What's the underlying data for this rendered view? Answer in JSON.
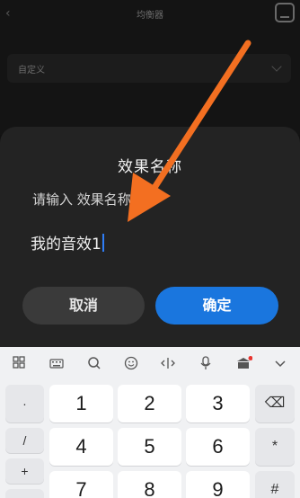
{
  "app": {
    "title": "均衡器",
    "preset_value": "自定义"
  },
  "dialog": {
    "title": "效果名称",
    "hint": "请输入 效果名称",
    "input_value": "我的音效1",
    "cancel_label": "取消",
    "confirm_label": "确定"
  },
  "keyboard": {
    "toolbar_icons": [
      "grid-icon",
      "keyboard-icon",
      "search-icon",
      "emoji-icon",
      "cursor-move-icon",
      "microphone-icon",
      "shop-icon",
      "collapse-icon"
    ],
    "side_keys": [
      "·",
      "/",
      "+",
      "−"
    ],
    "number_keys": [
      "1",
      "2",
      "3",
      "4",
      "5",
      "6",
      "7",
      "8",
      "9"
    ],
    "right_keys": [
      "⌫",
      "*",
      "#"
    ]
  },
  "colors": {
    "accent": "#1a76de",
    "annotation_arrow": "#f36f21"
  }
}
